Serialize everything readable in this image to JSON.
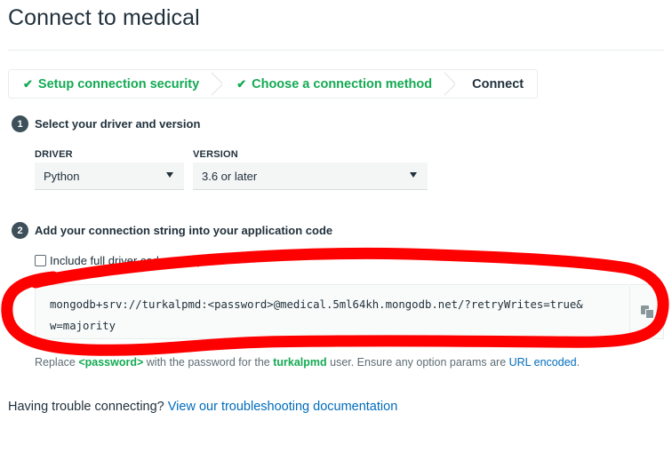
{
  "page": {
    "title": "Connect to medical"
  },
  "steps": [
    {
      "label": "Setup connection security",
      "state": "done"
    },
    {
      "label": "Choose a connection method",
      "state": "done"
    },
    {
      "label": "Connect",
      "state": "current"
    }
  ],
  "section1": {
    "number": "1",
    "title": "Select your driver and version"
  },
  "driver": {
    "label": "DRIVER",
    "value": "Python"
  },
  "version": {
    "label": "VERSION",
    "value": "3.6 or later"
  },
  "section2": {
    "number": "2",
    "title": "Add your connection string into your application code"
  },
  "include_example": {
    "label": "Include full driver code example",
    "checked": false
  },
  "connection_string": {
    "line1": "mongodb+srv://turkalpmd:<password>@medical.5ml64kh.mongodb.net/?retryWrites=true&",
    "line2": "w=majority"
  },
  "hint": {
    "prefix": "Replace ",
    "password_token": "<password>",
    "middle": " with the password for the ",
    "user": "turkalpmd",
    "suffix": " user. Ensure any option params are ",
    "link": "URL encoded",
    "end": "."
  },
  "trouble": {
    "text": "Having trouble connecting? ",
    "link": "View our troubleshooting documentation"
  },
  "annotation": {
    "color": "#ff0000"
  },
  "colors": {
    "accent_green": "#13aa52",
    "link_blue": "#006cbc",
    "text_dark": "#21313c"
  }
}
